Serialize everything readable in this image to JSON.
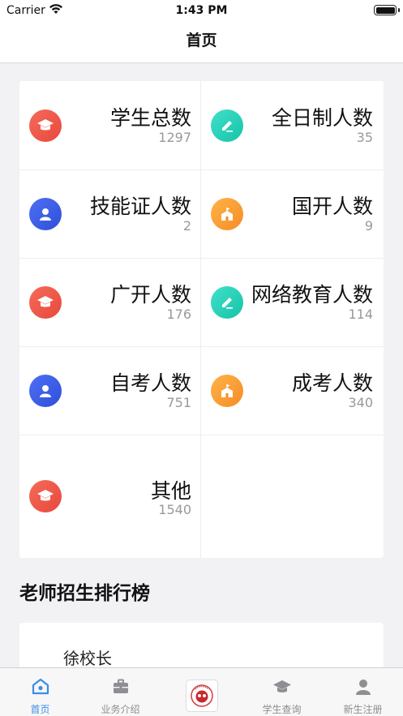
{
  "status_bar": {
    "carrier": "Carrier",
    "time": "1:43 PM"
  },
  "nav": {
    "title": "首页"
  },
  "stats": [
    {
      "title": "学生总数",
      "value": "1297",
      "icon": "graduation-cap-icon",
      "color": "red"
    },
    {
      "title": "全日制人数",
      "value": "35",
      "icon": "pencil-icon",
      "color": "teal"
    },
    {
      "title": "技能证人数",
      "value": "2",
      "icon": "person-icon",
      "color": "blue"
    },
    {
      "title": "国开人数",
      "value": "9",
      "icon": "school-building-icon",
      "color": "orange"
    },
    {
      "title": "广开人数",
      "value": "176",
      "icon": "graduation-cap-icon",
      "color": "red"
    },
    {
      "title": "网络教育人数",
      "value": "114",
      "icon": "pencil-icon",
      "color": "teal"
    },
    {
      "title": "自考人数",
      "value": "751",
      "icon": "person-icon",
      "color": "blue"
    },
    {
      "title": "成考人数",
      "value": "340",
      "icon": "school-building-icon",
      "color": "orange"
    },
    {
      "title": "其他",
      "value": "1540",
      "icon": "graduation-cap-icon",
      "color": "red"
    }
  ],
  "ranking": {
    "title": "老师招生排行榜",
    "items": [
      {
        "name": "徐校长"
      }
    ]
  },
  "tab_bar": {
    "items": [
      {
        "label": "首页",
        "icon": "home-icon",
        "active": true
      },
      {
        "label": "业务介绍",
        "icon": "briefcase-icon",
        "active": false
      },
      {
        "label": "",
        "icon": "logo-icon",
        "active": false
      },
      {
        "label": "学生查询",
        "icon": "graduation-cap-icon",
        "active": false
      },
      {
        "label": "新生注册",
        "icon": "person-icon",
        "active": false
      }
    ]
  },
  "colors": {
    "accent": "#3c8ce8",
    "red": "#e8483c",
    "teal": "#17c3a9",
    "blue": "#2f4fd8",
    "orange": "#f58c28"
  }
}
